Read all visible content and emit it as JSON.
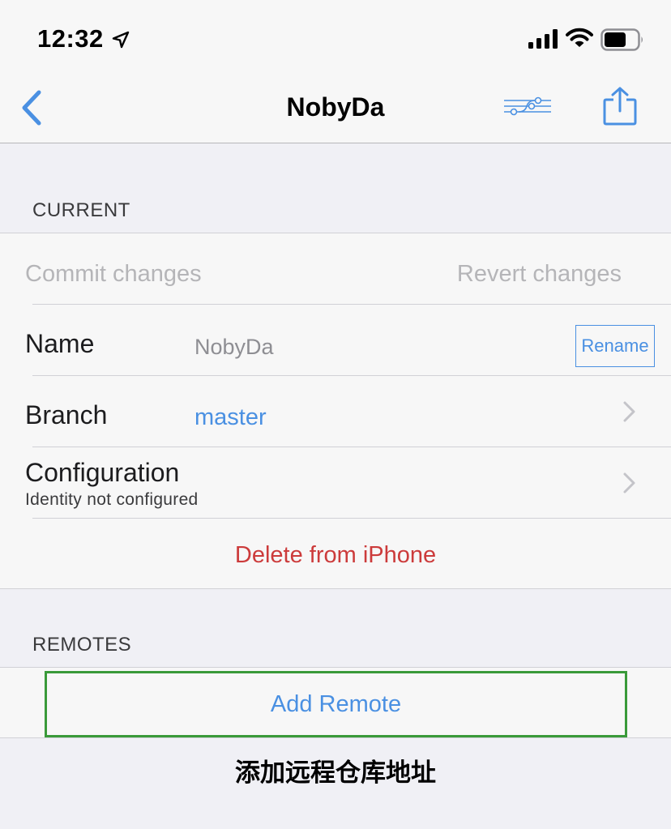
{
  "status_bar": {
    "time": "12:32"
  },
  "nav": {
    "title": "NobyDa"
  },
  "current": {
    "header": "CURRENT",
    "commit_label": "Commit changes",
    "revert_label": "Revert changes",
    "name_label": "Name",
    "name_value": "NobyDa",
    "rename_label": "Rename",
    "branch_label": "Branch",
    "branch_value": "master",
    "config_label": "Configuration",
    "config_sub": "Identity not configured",
    "delete_label": "Delete from iPhone"
  },
  "remotes": {
    "header": "REMOTES",
    "add_label": "Add Remote"
  },
  "caption": "添加远程仓库地址",
  "colors": {
    "accent": "#4a90e2",
    "destructive": "#cc3b3b",
    "highlight": "#3a9a3a"
  }
}
